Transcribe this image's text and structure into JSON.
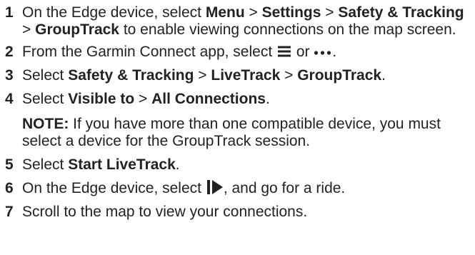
{
  "steps": [
    {
      "num": "1",
      "prefix": "On the Edge device, select ",
      "menu": "Menu",
      "sep1": " > ",
      "settings": "Settings",
      "sep2": " > ",
      "safety": "Safety & Tracking",
      "sep3": " > ",
      "grouptrack": "GroupTrack",
      "suffix": " to enable viewing connections on the map screen."
    },
    {
      "num": "2",
      "prefix": "From the Garmin Connect app, select ",
      "or": " or ",
      "suffix": "."
    },
    {
      "num": "3",
      "prefix": "Select ",
      "safety": "Safety & Tracking",
      "sep1": " > ",
      "livetrack": "LiveTrack",
      "sep2": " > ",
      "grouptrack": "GroupTrack",
      "suffix": "."
    },
    {
      "num": "4",
      "prefix": "Select ",
      "visible": "Visible to",
      "sep1": " > ",
      "all": "All Connections",
      "suffix": "."
    },
    {
      "num": "5",
      "prefix": "Select ",
      "start": "Start LiveTrack",
      "suffix": "."
    },
    {
      "num": "6",
      "prefix": "On the Edge device, select ",
      "suffix": ", and go for a ride."
    },
    {
      "num": "7",
      "text": "Scroll to the map to view your connections."
    }
  ],
  "note": {
    "label": "NOTE:",
    "text": " If you have more than one compatible device, you must select a device for the GroupTrack session."
  },
  "icons": {
    "menu": "hamburger-menu-icon",
    "more": "more-dots-icon",
    "play": "start-play-icon"
  }
}
